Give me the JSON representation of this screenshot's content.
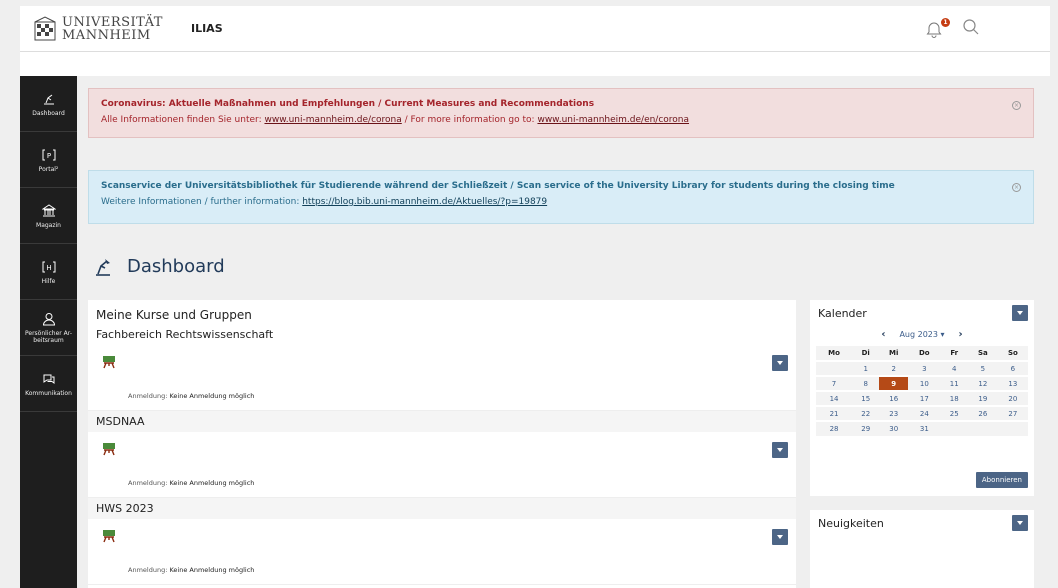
{
  "header": {
    "logo_line1": "UNIVERSITÄT",
    "logo_line2": "MANNHEIM",
    "app_name": "ILIAS",
    "notification_count": "1"
  },
  "sidebar": {
    "items": [
      {
        "label": "Dashboard",
        "icon": "dashboard-icon"
      },
      {
        "label": "Portal²",
        "icon": "portal-icon"
      },
      {
        "label": "Magazin",
        "icon": "bank-icon"
      },
      {
        "label": "Hilfe",
        "icon": "help-icon"
      },
      {
        "label": "Persönlicher Ar-beitsraum",
        "icon": "user-icon"
      },
      {
        "label": "Kommunikation",
        "icon": "chat-icon"
      }
    ]
  },
  "alerts": {
    "corona": {
      "title": "Coronavirus: Aktuelle Maßnahmen und Empfehlungen / Current Measures and Recommendations",
      "prefix": "Alle Informationen finden Sie unter: ",
      "link1": "www.uni-mannheim.de/corona",
      "middle": " / For more information go to: ",
      "link2": "www.uni-mannheim.de/en/corona"
    },
    "scan": {
      "title": "Scanservice der Universitätsbibliothek für Studierende während der Schließzeit / Scan service of the University Library for students during the closing time",
      "prefix": "Weitere Informationen / further information: ",
      "link": "https://blog.bib.uni-mannheim.de/Aktuelles/?p=19879"
    }
  },
  "page": {
    "title": "Dashboard"
  },
  "courses": {
    "heading": "Meine Kurse und Gruppen",
    "groups": [
      {
        "title": "Fachbereich Rechtswissenschaft",
        "meta_label": "Anmeldung:",
        "meta_value": "Keine Anmeldung möglich"
      },
      {
        "title": "MSDNAA",
        "meta_label": "Anmeldung:",
        "meta_value": "Keine Anmeldung möglich"
      },
      {
        "title": "HWS 2023",
        "meta_label": "Anmeldung:",
        "meta_value": "Keine Anmeldung möglich"
      }
    ]
  },
  "calendar": {
    "title": "Kalender",
    "month": "Aug 2023",
    "weekdays": [
      "Mo",
      "Di",
      "Mi",
      "Do",
      "Fr",
      "Sa",
      "So"
    ],
    "weeks": [
      [
        "",
        "1",
        "2",
        "3",
        "4",
        "5",
        "6"
      ],
      [
        "7",
        "8",
        "9",
        "10",
        "11",
        "12",
        "13"
      ],
      [
        "14",
        "15",
        "16",
        "17",
        "18",
        "19",
        "20"
      ],
      [
        "21",
        "22",
        "23",
        "24",
        "25",
        "26",
        "27"
      ],
      [
        "28",
        "29",
        "30",
        "31",
        "",
        "",
        ""
      ]
    ],
    "today": "9",
    "subscribe_label": "Abonnieren",
    "accent": "#b54a17"
  },
  "news": {
    "title": "Neuigkeiten"
  },
  "colors": {
    "primary": "#4c6586",
    "title": "#223b5a"
  }
}
